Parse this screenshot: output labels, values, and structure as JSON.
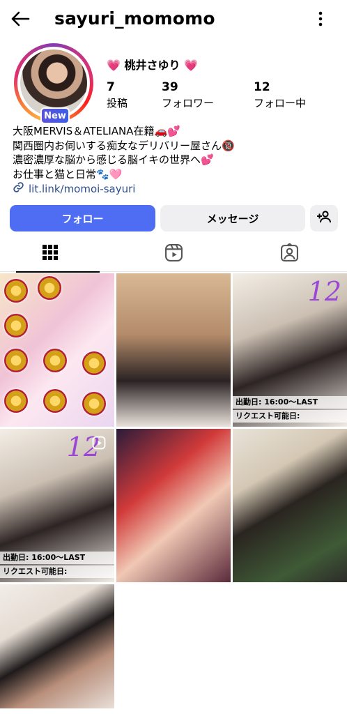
{
  "header": {
    "username": "sayuri_momomo"
  },
  "profile": {
    "new_badge": "New",
    "display_name": "💗 桃井さゆり 💗",
    "stats": [
      {
        "value": "7",
        "label": "投稿"
      },
      {
        "value": "39",
        "label": "フォロワー"
      },
      {
        "value": "12",
        "label": "フォロー中"
      }
    ],
    "bio": [
      "大阪MERVIS＆ATELIANA在籍🚗💕",
      "関西圏内お伺いする痴女なデリバリー屋さん🔞",
      "濃密濃厚な脳から感じる脳イキの世界へ💕",
      "お仕事と猫と日常🐾🩷"
    ],
    "link": "lit.link/momoi-sayuri"
  },
  "actions": {
    "follow": "フォロー",
    "message": "メッセージ"
  },
  "posts": {
    "calendar_number": "12",
    "calendar_time": "出勤日: 16:00〜LAST",
    "calendar_request": "リクエスト可能日:"
  },
  "colors": {
    "accent": "#4e6df2",
    "link": "#2d4f8e",
    "new_badge": "#5b51d8"
  }
}
